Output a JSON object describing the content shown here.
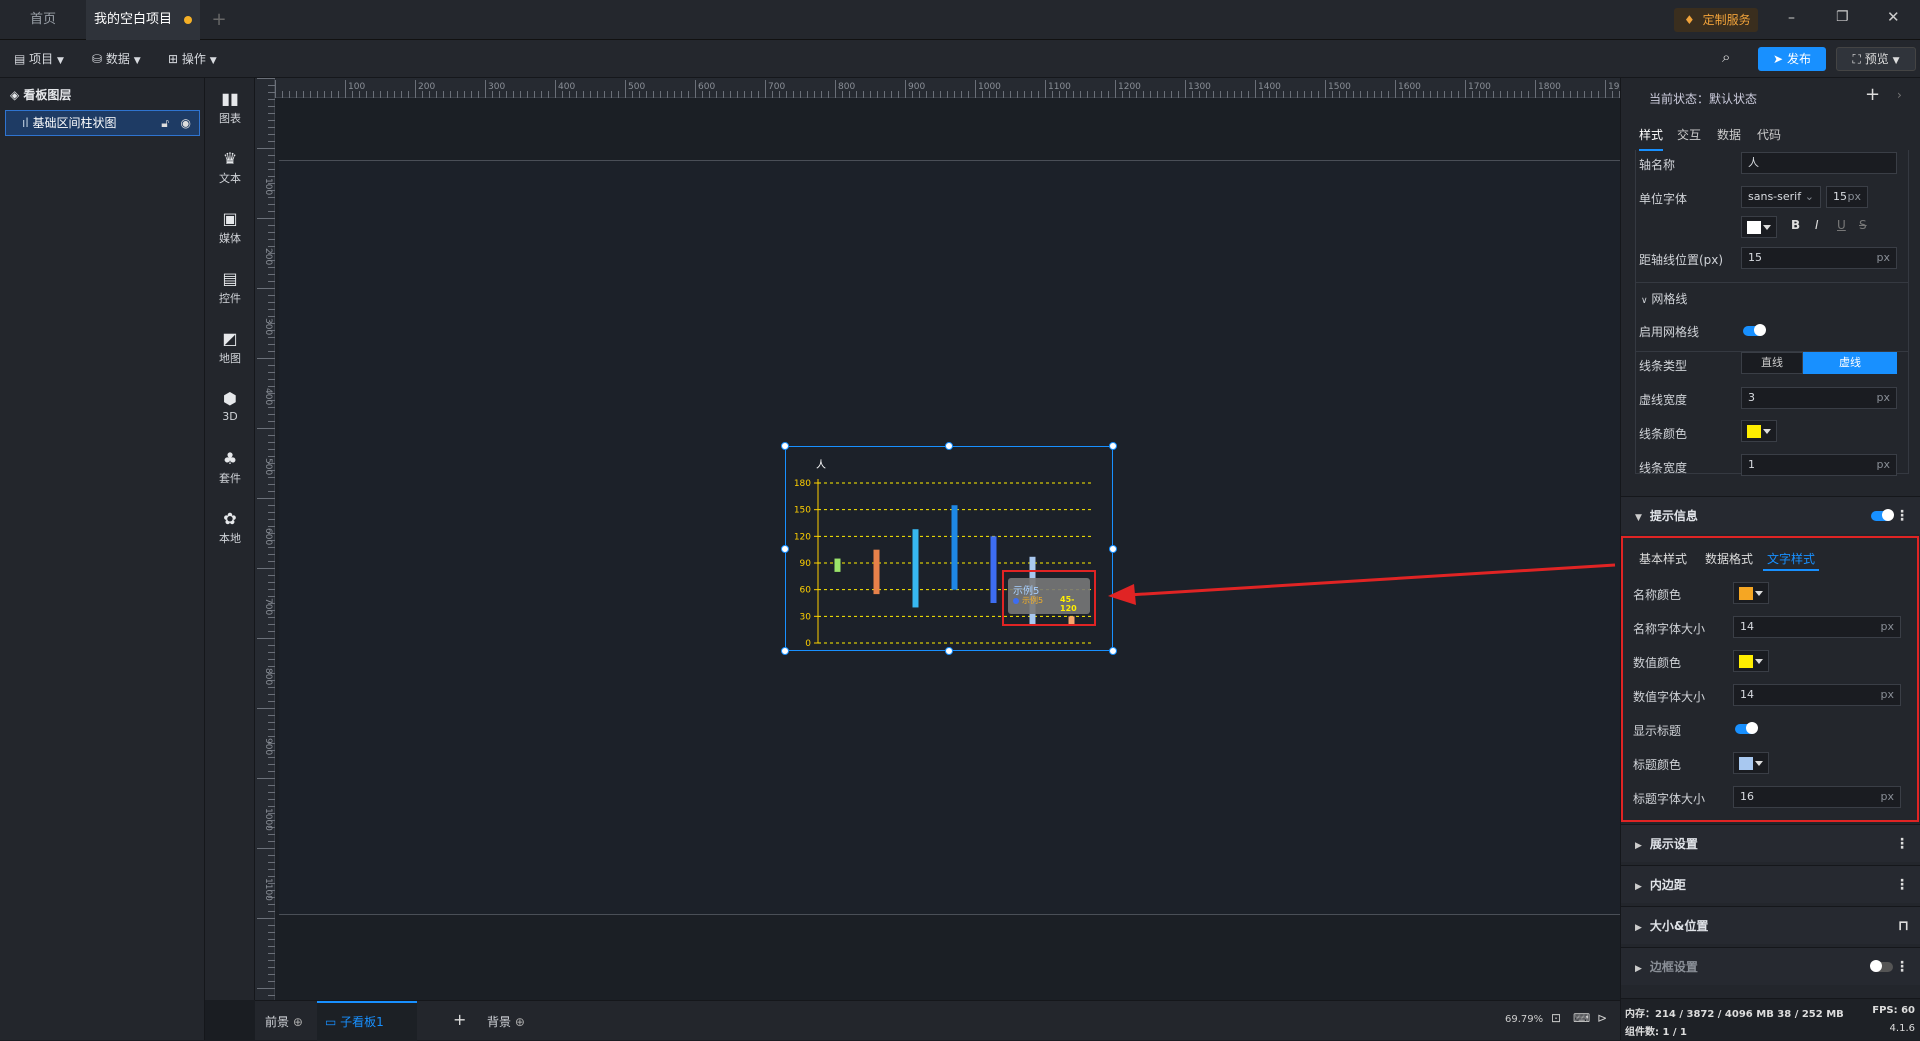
{
  "tabs": {
    "home": "首页",
    "project": "我的空白项目",
    "custom_service": "定制服务"
  },
  "toolbar": {
    "project": "项目",
    "data": "数据",
    "operate": "操作",
    "publish": "发布",
    "preview": "预览"
  },
  "layers": {
    "title": "看板图层",
    "item": "基础区间柱状图"
  },
  "components": [
    "图表",
    "文本",
    "媒体",
    "控件",
    "地图",
    "3D",
    "套件",
    "本地"
  ],
  "ruler": {
    "top": [
      "100",
      "200",
      "300",
      "400",
      "500",
      "600",
      "700",
      "800",
      "900",
      "1000",
      "1100",
      "1200",
      "1300",
      "1400",
      "1500",
      "1600",
      "1700",
      "1800",
      "1900"
    ],
    "left": [
      "100",
      "200",
      "300",
      "400",
      "500",
      "600",
      "700",
      "800",
      "900",
      "1000",
      "1100"
    ]
  },
  "chart_data": {
    "type": "bar",
    "title": "",
    "ylabel": "人",
    "yticks": [
      "180",
      "150",
      "120",
      "90",
      "60",
      "30",
      "0"
    ],
    "ylim": [
      0,
      180
    ],
    "grid": "dashed",
    "series": [
      {
        "values": [
          [
            80,
            95
          ],
          [
            55,
            105
          ],
          [
            40,
            128
          ],
          [
            60,
            155
          ],
          [
            45,
            120
          ],
          [
            20,
            97
          ],
          [
            20,
            30
          ]
        ],
        "colors": [
          "#9be36a",
          "#e7814a",
          "#37b7f0",
          "#1e88e5",
          "#3d6df2",
          "#a8c8f0",
          "#f5a56b"
        ]
      }
    ],
    "tooltip": {
      "title": "示例5",
      "item_label": "示例5",
      "item_value": "45-120"
    }
  },
  "bottom": {
    "foreground": "前景",
    "subboard": "子看板1",
    "background": "背景",
    "zoom": "69.79%"
  },
  "right": {
    "state_label": "当前状态：默认状态",
    "tabs": [
      "样式",
      "交互",
      "数据",
      "代码"
    ],
    "axis_name_label": "轴名称",
    "axis_name_value": "人",
    "unit_font_label": "单位字体",
    "font_family": "sans-serif",
    "font_size": "15",
    "axis_distance_label": "距轴线位置(px)",
    "axis_distance": "15",
    "grid_section": "网格线",
    "enable_grid": "启用网格线",
    "line_type": "线条类型",
    "solid": "直线",
    "dashed": "虚线",
    "dash_width": "虚线宽度",
    "dash_width_value": "3",
    "line_color": "线条颜色",
    "line_width": "线条宽度",
    "line_width_value": "1",
    "tooltip_section": "提示信息",
    "tooltip_tabs": [
      "基本样式",
      "数据格式",
      "文字样式"
    ],
    "name_color": "名称颜色",
    "name_font_size": "名称字体大小",
    "name_font_size_value": "14",
    "value_color": "数值颜色",
    "value_font_size": "数值字体大小",
    "value_font_size_value": "14",
    "show_title": "显示标题",
    "title_color": "标题颜色",
    "title_font_size": "标题字体大小",
    "title_font_size_value": "16",
    "display_settings": "展示设置",
    "padding": "内边距",
    "size_position": "大小&位置",
    "border_settings": "边框设置",
    "px": "px",
    "status_memory": "内存：214 / 3872 / 4096 MB  38 / 252 MB",
    "status_fps": "FPS:  60",
    "status_count": "组件数: 1 / 1",
    "version": "4.1.6"
  },
  "colors": {
    "accent": "#1890ff",
    "highlight_red": "#e02424",
    "grid_yellow": "#ffee00"
  }
}
